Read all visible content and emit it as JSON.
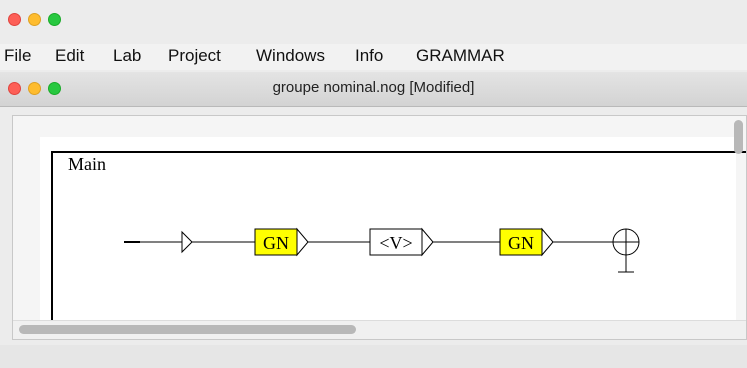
{
  "app": {
    "menu": [
      "File",
      "Edit",
      "Lab",
      "Project",
      "Windows",
      "Info",
      "GRAMMAR"
    ]
  },
  "internal_window": {
    "title": "groupe nominal.nog [Modified]"
  },
  "graph": {
    "frame_title": "Main",
    "boxes": [
      {
        "label": "GN",
        "highlight": "#ffff00"
      },
      {
        "label": "<V>",
        "highlight": "#ffffff"
      },
      {
        "label": "GN",
        "highlight": "#ffff00"
      }
    ]
  },
  "colors": {
    "mac_red": "#fd5f57",
    "mac_yellow": "#febc2e",
    "mac_green": "#28c840",
    "box_yellow": "#ffff00"
  }
}
